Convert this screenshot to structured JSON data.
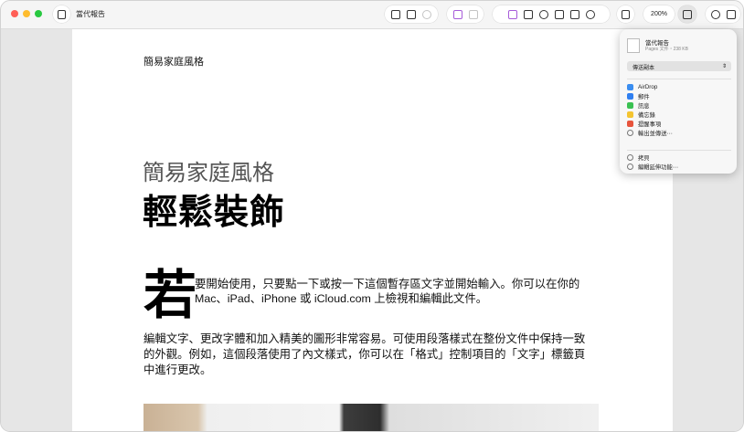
{
  "window": {
    "title": "當代報告",
    "zoom": "200%"
  },
  "document": {
    "header": "簡易家庭風格",
    "subtitle": "簡易家庭風格",
    "title": "輕鬆裝飾",
    "dropcap": "若",
    "para1": "要開始使用，只要點一下或按一下這個暫存區文字並開始輸入。你可以在你的 Mac、iPad、iPhone 或 iCloud.com 上檢視和編輯此文件。",
    "para2": "編輯文字、更改字體和加入精美的圖形非常容易。可使用段落樣式在整份文件中保持一致的外觀。例如，這個段落使用了內文樣式，你可以在「格式」控制項目的「文字」標籤頁中進行更改。"
  },
  "share": {
    "doc_name": "當代報告",
    "doc_meta": "Pages 文件・238 KB",
    "mode": "傳送副本",
    "items": [
      {
        "label": "AirDrop",
        "color": "#3a8df0"
      },
      {
        "label": "郵件",
        "color": "#2f7ff0"
      },
      {
        "label": "訊息",
        "color": "#3ac152"
      },
      {
        "label": "備忘錄",
        "color": "#f4c430"
      },
      {
        "label": "提醒事項",
        "color": "#e7543c"
      },
      {
        "label": "輸出並傳送⋯",
        "color": "#777777"
      },
      {
        "label": "拷貝",
        "color": "#777777"
      },
      {
        "label": "編輯延伸功能⋯",
        "color": "#777777"
      }
    ]
  },
  "colors": {
    "close": "#ff5f57",
    "minimize": "#febc2e",
    "zoom": "#28c840",
    "media_accent": "#a75bd9"
  }
}
